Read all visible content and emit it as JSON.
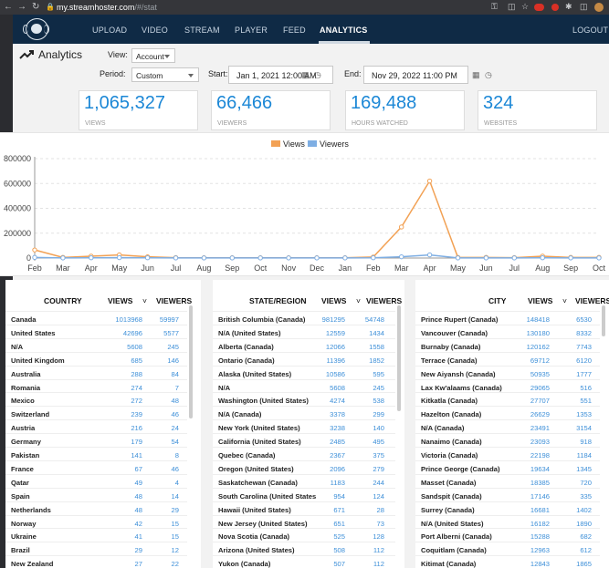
{
  "browser": {
    "host": "my.streamhoster.com",
    "path": "/#/stat"
  },
  "nav": {
    "items": [
      "UPLOAD",
      "VIDEO",
      "STREAM",
      "PLAYER",
      "FEED",
      "ANALYTICS"
    ],
    "logout": "LOGOUT"
  },
  "page": {
    "title": "Analytics"
  },
  "filters": {
    "view_label": "View:",
    "view_value": "Account",
    "period_label": "Period:",
    "period_value": "Custom",
    "start_label": "Start:",
    "start_value": "Jan 1, 2021 12:00 AM",
    "end_label": "End:",
    "end_value": "Nov 29, 2022 11:00 PM"
  },
  "stats": [
    {
      "value": "1,065,327",
      "caption": "VIEWS"
    },
    {
      "value": "66,466",
      "caption": "VIEWERS"
    },
    {
      "value": "169,488",
      "caption": "HOURS WATCHED"
    },
    {
      "value": "324",
      "caption": "WEBSITES"
    }
  ],
  "chart_data": {
    "type": "line",
    "categories": [
      "Feb",
      "Mar",
      "Apr",
      "May",
      "Jun",
      "Jul",
      "Aug",
      "Sep",
      "Oct",
      "Nov",
      "Dec",
      "Jan",
      "Feb",
      "Mar",
      "Apr",
      "May",
      "Jun",
      "Jul",
      "Aug",
      "Sep",
      "Oct"
    ],
    "series": [
      {
        "name": "Views",
        "color": "#f2a154",
        "values": [
          65000,
          5000,
          15000,
          25000,
          10000,
          3000,
          2000,
          2000,
          2000,
          2000,
          2000,
          2000,
          8000,
          250000,
          620000,
          5000,
          5000,
          3000,
          15000,
          5000,
          5000
        ]
      },
      {
        "name": "Viewers",
        "color": "#7eaee3",
        "values": [
          5000,
          1000,
          2000,
          3000,
          2000,
          1000,
          1000,
          1000,
          1000,
          1000,
          1000,
          1000,
          2000,
          10000,
          25000,
          1000,
          1000,
          1000,
          2000,
          1000,
          1000
        ]
      }
    ],
    "yticks": [
      "800000",
      "600000",
      "400000",
      "200000",
      "0"
    ],
    "ylim": [
      0,
      800000
    ],
    "grid": true,
    "legend": "top-center"
  },
  "tables": [
    {
      "headers": [
        "COUNTRY",
        "VIEWS",
        "VIEWERS"
      ],
      "rows": [
        [
          "Canada",
          "1013968",
          "59997"
        ],
        [
          "United States",
          "42696",
          "5577"
        ],
        [
          "N/A",
          "5608",
          "245"
        ],
        [
          "United Kingdom",
          "685",
          "146"
        ],
        [
          "Australia",
          "288",
          "84"
        ],
        [
          "Romania",
          "274",
          "7"
        ],
        [
          "Mexico",
          "272",
          "48"
        ],
        [
          "Switzerland",
          "239",
          "46"
        ],
        [
          "Austria",
          "216",
          "24"
        ],
        [
          "Germany",
          "179",
          "54"
        ],
        [
          "Pakistan",
          "141",
          "8"
        ],
        [
          "France",
          "67",
          "46"
        ],
        [
          "Qatar",
          "49",
          "4"
        ],
        [
          "Spain",
          "48",
          "14"
        ],
        [
          "Netherlands",
          "48",
          "29"
        ],
        [
          "Norway",
          "42",
          "15"
        ],
        [
          "Ukraine",
          "41",
          "15"
        ],
        [
          "Brazil",
          "29",
          "12"
        ],
        [
          "New Zealand",
          "27",
          "22"
        ]
      ]
    },
    {
      "headers": [
        "STATE/REGION",
        "VIEWS",
        "VIEWERS"
      ],
      "rows": [
        [
          "British Columbia (Canada)",
          "981295",
          "54748"
        ],
        [
          "N/A (United States)",
          "12559",
          "1434"
        ],
        [
          "Alberta (Canada)",
          "12066",
          "1558"
        ],
        [
          "Ontario (Canada)",
          "11396",
          "1852"
        ],
        [
          "Alaska (United States)",
          "10586",
          "595"
        ],
        [
          "N/A",
          "5608",
          "245"
        ],
        [
          "Washington (United States)",
          "4274",
          "538"
        ],
        [
          "N/A (Canada)",
          "3378",
          "299"
        ],
        [
          "New York (United States)",
          "3238",
          "140"
        ],
        [
          "California (United States)",
          "2485",
          "495"
        ],
        [
          "Quebec (Canada)",
          "2367",
          "375"
        ],
        [
          "Oregon (United States)",
          "2096",
          "279"
        ],
        [
          "Saskatchewan (Canada)",
          "1183",
          "244"
        ],
        [
          "South Carolina (United States",
          "954",
          "124"
        ],
        [
          "Hawaii (United States)",
          "671",
          "28"
        ],
        [
          "New Jersey (United States)",
          "651",
          "73"
        ],
        [
          "Nova Scotia (Canada)",
          "525",
          "128"
        ],
        [
          "Arizona (United States)",
          "508",
          "112"
        ],
        [
          "Yukon (Canada)",
          "507",
          "112"
        ]
      ]
    },
    {
      "headers": [
        "CITY",
        "VIEWS",
        "VIEWERS"
      ],
      "rows": [
        [
          "Prince Rupert (Canada)",
          "148418",
          "6530"
        ],
        [
          "Vancouver (Canada)",
          "130180",
          "8332"
        ],
        [
          "Burnaby (Canada)",
          "120162",
          "7743"
        ],
        [
          "Terrace (Canada)",
          "69712",
          "6120"
        ],
        [
          "New Aiyansh (Canada)",
          "50935",
          "1777"
        ],
        [
          "Lax Kw'alaams (Canada)",
          "29065",
          "516"
        ],
        [
          "Kitkatla (Canada)",
          "27707",
          "551"
        ],
        [
          "Hazelton (Canada)",
          "26629",
          "1353"
        ],
        [
          "N/A (Canada)",
          "23491",
          "3154"
        ],
        [
          "Nanaimo (Canada)",
          "23093",
          "918"
        ],
        [
          "Victoria (Canada)",
          "22198",
          "1184"
        ],
        [
          "Prince George (Canada)",
          "19634",
          "1345"
        ],
        [
          "Masset (Canada)",
          "18385",
          "720"
        ],
        [
          "Sandspit (Canada)",
          "17146",
          "335"
        ],
        [
          "Surrey (Canada)",
          "16681",
          "1402"
        ],
        [
          "N/A (United States)",
          "16182",
          "1890"
        ],
        [
          "Port Alberni (Canada)",
          "15288",
          "682"
        ],
        [
          "Coquitlam (Canada)",
          "12963",
          "612"
        ],
        [
          "Kitimat (Canada)",
          "12843",
          "1865"
        ]
      ]
    }
  ],
  "sort_marker": "˅"
}
